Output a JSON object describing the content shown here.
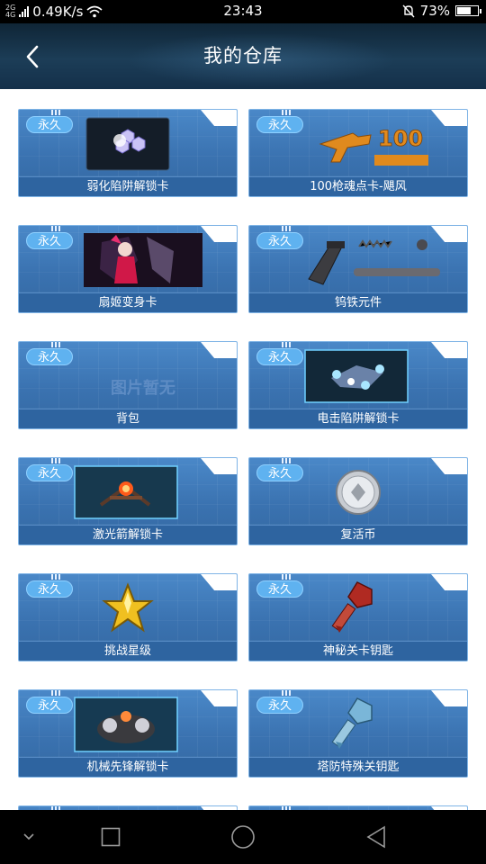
{
  "status_bar": {
    "network_top": "2G",
    "network_bottom": "4G",
    "speed": "0.49K/s",
    "time": "23:43",
    "battery": "73%",
    "battery_level": 0.73
  },
  "header": {
    "title": "我的仓库",
    "back_icon": "chevron-left-icon"
  },
  "items": [
    {
      "badge": "永久",
      "label": "弱化陷阱解锁卡",
      "image": "trap-card-image"
    },
    {
      "badge": "永久",
      "label": "100枪魂点卡-飓风",
      "image": "gun-points-image",
      "image_text": "100"
    },
    {
      "badge": "永久",
      "label": "扇姬变身卡",
      "image": "character-image"
    },
    {
      "badge": "永久",
      "label": "钨铁元件",
      "image": "gun-parts-image"
    },
    {
      "badge": "永久",
      "label": "背包",
      "image": "no-image",
      "image_text": "图片暂无"
    },
    {
      "badge": "永久",
      "label": "电击陷阱解锁卡",
      "image": "electric-trap-image"
    },
    {
      "badge": "永久",
      "label": "激光箭解锁卡",
      "image": "laser-arrow-image"
    },
    {
      "badge": "永久",
      "label": "复活币",
      "image": "coin-image"
    },
    {
      "badge": "永久",
      "label": "挑战星级",
      "image": "star-image"
    },
    {
      "badge": "永久",
      "label": "神秘关卡钥匙",
      "image": "red-key-image"
    },
    {
      "badge": "永久",
      "label": "机械先锋解锁卡",
      "image": "mech-image"
    },
    {
      "badge": "永久",
      "label": "塔防特殊关钥匙",
      "image": "blue-key-image"
    }
  ],
  "nav_bar": [
    "chevron-down-icon",
    "recent-apps-icon",
    "home-icon",
    "back-triangle-icon"
  ]
}
